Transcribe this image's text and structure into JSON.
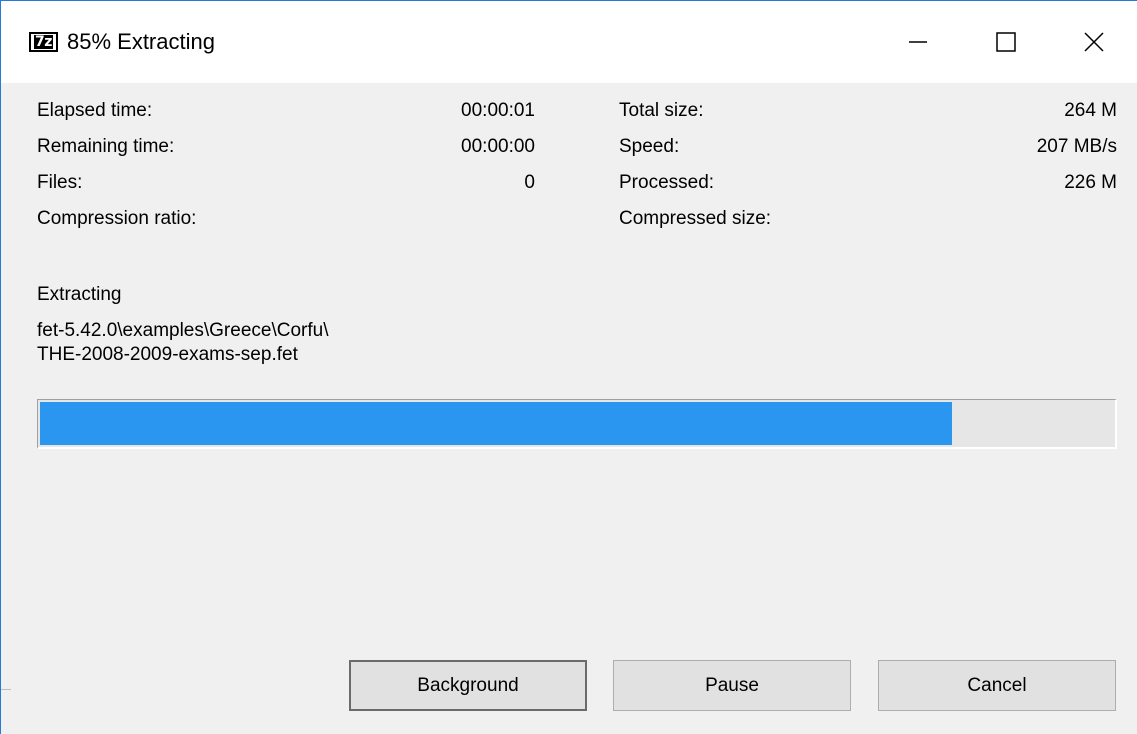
{
  "window": {
    "title": "85% Extracting",
    "icon_text": "7z",
    "controls": {
      "minimize_icon": "minimize-icon",
      "maximize_icon": "maximize-icon",
      "close_icon": "close-icon"
    }
  },
  "stats": {
    "elapsed_label": "Elapsed time:",
    "elapsed_value": "00:00:01",
    "remaining_label": "Remaining time:",
    "remaining_value": "00:00:00",
    "files_label": "Files:",
    "files_value": "0",
    "ratio_label": "Compression ratio:",
    "total_size_label": "Total size:",
    "total_size_value": "264 M",
    "speed_label": "Speed:",
    "speed_value": "207 MB/s",
    "processed_label": "Processed:",
    "processed_value": "226 M",
    "compressed_size_label": "Compressed size:"
  },
  "operation": {
    "label": "Extracting",
    "current_file": "fet-5.42.0\\examples\\Greece\\Corfu\\\nTHE-2008-2009-exams-sep.fet"
  },
  "progress": {
    "percent": 85,
    "fill_color": "#2a96ef"
  },
  "buttons": {
    "background_label": "Background",
    "pause_label": "Pause",
    "cancel_label": "Cancel"
  },
  "colors": {
    "dialog_bg": "#f0f0f0",
    "titlebar_bg": "#ffffff",
    "window_border": "#2b79d6"
  }
}
